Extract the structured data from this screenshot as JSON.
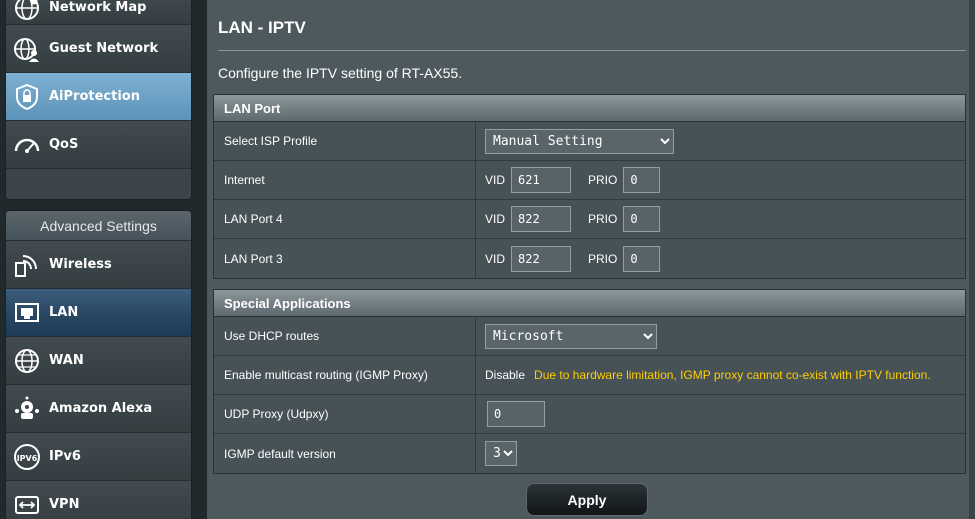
{
  "sidebar": {
    "top_items": [
      {
        "label": "Network Map",
        "icon": "network-map-icon"
      },
      {
        "label": "Guest Network",
        "icon": "guest-network-icon"
      },
      {
        "label": "AiProtection",
        "icon": "shield-icon"
      },
      {
        "label": "QoS",
        "icon": "speedometer-icon"
      }
    ],
    "advanced_header": "Advanced Settings",
    "advanced_items": [
      {
        "label": "Wireless",
        "icon": "wifi-icon"
      },
      {
        "label": "LAN",
        "icon": "lan-icon"
      },
      {
        "label": "WAN",
        "icon": "globe-icon"
      },
      {
        "label": "Amazon Alexa",
        "icon": "alexa-icon"
      },
      {
        "label": "IPv6",
        "icon": "ipv6-icon"
      },
      {
        "label": "VPN",
        "icon": "vpn-icon"
      }
    ]
  },
  "main": {
    "title": "LAN - IPTV",
    "description": "Configure the IPTV setting of RT-AX55.",
    "lan_port": {
      "header": "LAN Port",
      "isp_profile_label": "Select ISP Profile",
      "isp_profile_value": "Manual Setting",
      "vid_label": "VID",
      "prio_label": "PRIO",
      "rows": [
        {
          "label": "Internet",
          "vid": "621",
          "prio": "0"
        },
        {
          "label": "LAN Port 4",
          "vid": "822",
          "prio": "0"
        },
        {
          "label": "LAN Port 3",
          "vid": "822",
          "prio": "0"
        }
      ]
    },
    "special": {
      "header": "Special Applications",
      "dhcp_label": "Use DHCP routes",
      "dhcp_value": "Microsoft",
      "igmp_label": "Enable multicast routing (IGMP Proxy)",
      "igmp_value": "Disable",
      "igmp_warning": "Due to hardware limitation, IGMP proxy cannot co-exist with IPTV function.",
      "udpxy_label": "UDP Proxy (Udpxy)",
      "udpxy_value": "0",
      "igmp_version_label": "IGMP default version",
      "igmp_version_value": "3"
    },
    "apply_label": "Apply"
  },
  "colors": {
    "accent_blue": "#6da1c6",
    "warning": "#ffcc00",
    "panel": "#4d595d"
  }
}
